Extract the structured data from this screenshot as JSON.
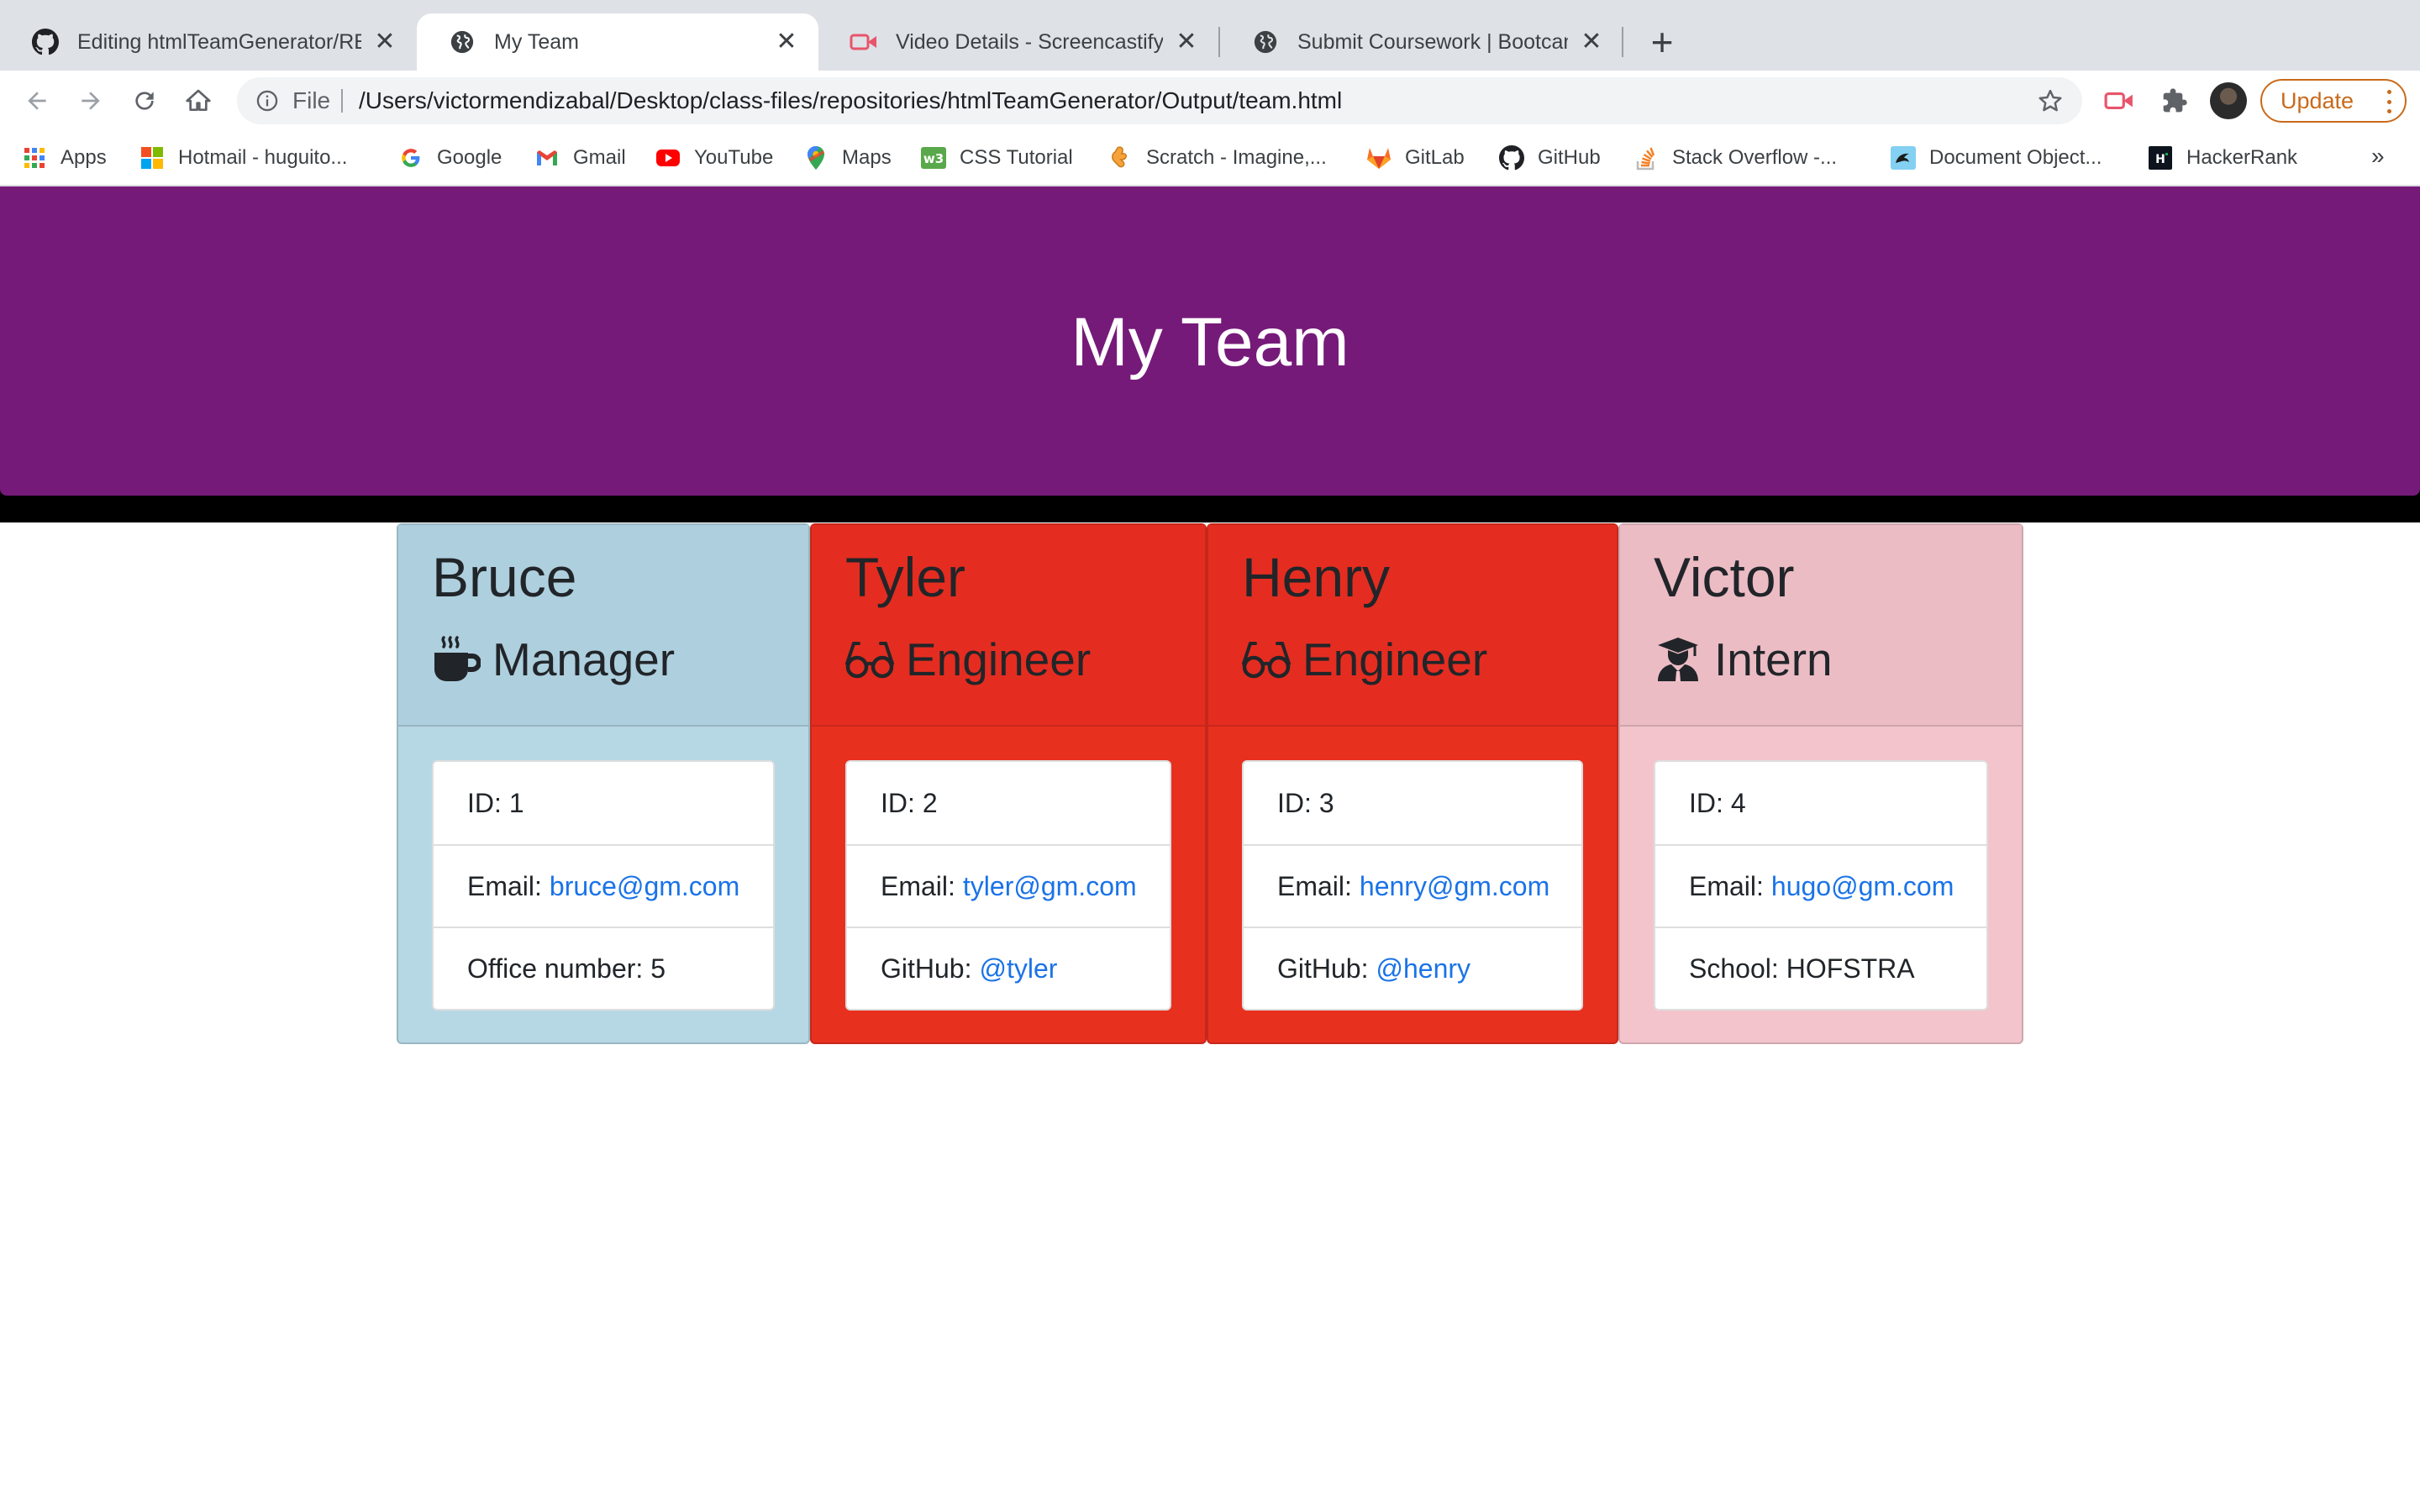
{
  "browser": {
    "tabs": [
      {
        "title": "Editing htmlTeamGenerator/RE",
        "icon": "github-icon",
        "active": false
      },
      {
        "title": "My Team",
        "icon": "globe-icon",
        "active": true
      },
      {
        "title": "Video Details - Screencastify",
        "icon": "screencastify-icon",
        "active": false
      },
      {
        "title": "Submit Coursework | Bootcamp",
        "icon": "globe-icon",
        "active": false
      }
    ],
    "new_tab_label": "+",
    "close_label": "✕",
    "omnibox": {
      "scheme": "File",
      "url": "/Users/victormendizabal/Desktop/class-files/repositories/htmlTeamGenerator/Output/team.html"
    },
    "update_label": "Update",
    "bookmarks": [
      {
        "label": "Apps",
        "icon": "apps-grid-icon"
      },
      {
        "label": "Hotmail - huguito...",
        "icon": "microsoft-icon"
      },
      {
        "label": "Google",
        "icon": "google-icon"
      },
      {
        "label": "Gmail",
        "icon": "gmail-icon"
      },
      {
        "label": "YouTube",
        "icon": "youtube-icon"
      },
      {
        "label": "Maps",
        "icon": "maps-pin-icon"
      },
      {
        "label": "CSS Tutorial",
        "icon": "w3schools-icon"
      },
      {
        "label": "Scratch - Imagine,...",
        "icon": "scratch-icon"
      },
      {
        "label": "GitLab",
        "icon": "gitlab-icon"
      },
      {
        "label": "GitHub",
        "icon": "github-icon"
      },
      {
        "label": "Stack Overflow -...",
        "icon": "stackoverflow-icon"
      },
      {
        "label": "Document Object...",
        "icon": "mdn-icon"
      },
      {
        "label": "HackerRank",
        "icon": "hackerrank-icon"
      }
    ],
    "bookmarks_more": "»"
  },
  "page": {
    "title": "My Team",
    "colors": {
      "jumbotron": "#761a7a",
      "manager": "#b8dce6",
      "engineer": "#e8301f",
      "intern": "#f3c3cb",
      "link": "#1a73e8"
    },
    "cards": [
      {
        "name": "Bruce",
        "role": "Manager",
        "role_icon": "coffee-mug-icon",
        "id_label": "ID:",
        "id": "1",
        "email_label": "Email:",
        "email": "bruce@gm.com",
        "extra_label": "Office number:",
        "extra_value": "5"
      },
      {
        "name": "Tyler",
        "role": "Engineer",
        "role_icon": "glasses-icon",
        "id_label": "ID:",
        "id": "2",
        "email_label": "Email:",
        "email": "tyler@gm.com",
        "extra_label": "GitHub:",
        "extra_value": "@tyler"
      },
      {
        "name": "Henry",
        "role": "Engineer",
        "role_icon": "glasses-icon",
        "id_label": "ID:",
        "id": "3",
        "email_label": "Email:",
        "email": "henry@gm.com",
        "extra_label": "GitHub:",
        "extra_value": "@henry"
      },
      {
        "name": "Victor",
        "role": "Intern",
        "role_icon": "graduate-icon",
        "id_label": "ID:",
        "id": "4",
        "email_label": "Email:",
        "email": "hugo@gm.com",
        "extra_label": "School:",
        "extra_value": "HOFSTRA"
      }
    ]
  }
}
